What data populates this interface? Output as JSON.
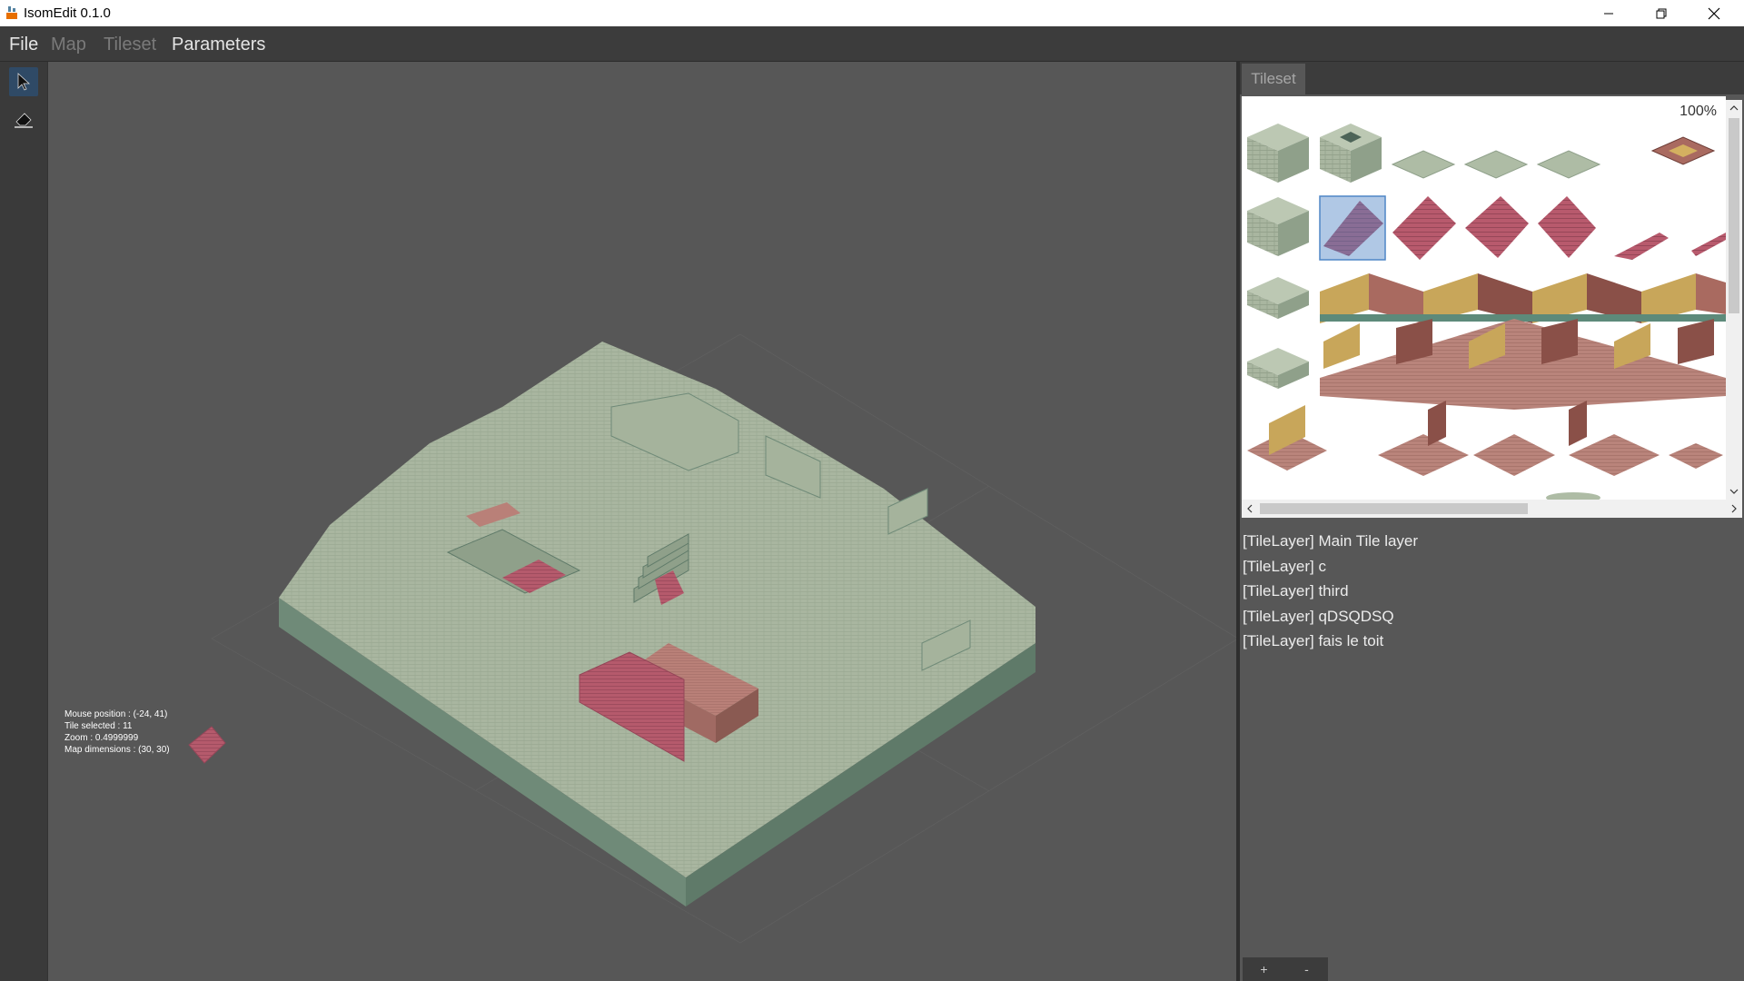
{
  "window": {
    "title": "IsomEdit 0.1.0"
  },
  "menu": {
    "file": "File",
    "map": "Map",
    "tileset": "Tileset",
    "parameters": "Parameters"
  },
  "tools": [
    {
      "icon": "select-arrow-icon",
      "selected": true
    },
    {
      "icon": "eraser-icon",
      "selected": false
    }
  ],
  "status": {
    "mouse_position": "Mouse position : (-24, 41)",
    "tile_selected": "Tile selected : 11",
    "zoom": "Zoom : 0.4999999",
    "map_dimensions": "Map dimensions : (30, 30)"
  },
  "tileset_panel": {
    "tab": "Tileset",
    "zoom": "100%",
    "selected_tile_index": 11
  },
  "layers": [
    "[TileLayer] Main Tile layer",
    "[TileLayer] c",
    "[TileLayer] third",
    "[TileLayer] qDSQDSQ",
    "[TileLayer] fais le toit"
  ],
  "layer_buttons": {
    "add": "+",
    "remove": "-"
  },
  "colors": {
    "stone": "#a5b39c",
    "stone_side": "#6f8a78",
    "roof": "#b8576a",
    "floor": "#b98078",
    "selection": "#4f86c6"
  }
}
